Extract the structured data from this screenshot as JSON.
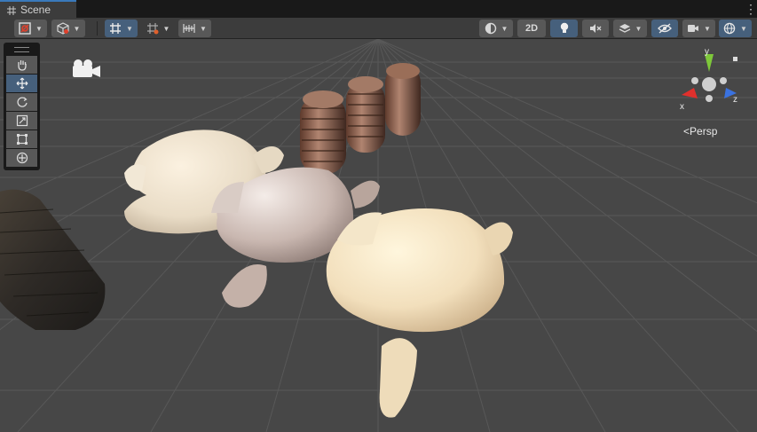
{
  "tab": {
    "title": "Scene"
  },
  "toolbar": {
    "draw_mode_icon": "render-mode-icon",
    "shading_icon": "cube-icon",
    "grid_snap_icon": "grid-icon",
    "increment_snap_icon": "snap-grid-icon",
    "ruler_icon": "ruler-icon",
    "lighting_icon": "sphere-shading-icon",
    "mode_2d_label": "2D",
    "light_icon": "lightbulb-icon",
    "audio_icon": "audio-mute-icon",
    "effects_icon": "layers-icon",
    "visibility_icon": "hidden-eye-icon",
    "camera_icon": "camera-icon",
    "gizmos_icon": "gizmo-globe-icon"
  },
  "tools": [
    {
      "name": "hand-tool",
      "icon": "hand-icon"
    },
    {
      "name": "move-tool",
      "icon": "move-arrows-icon",
      "active": true
    },
    {
      "name": "rotate-tool",
      "icon": "rotate-icon"
    },
    {
      "name": "scale-tool",
      "icon": "scale-icon"
    },
    {
      "name": "rect-tool",
      "icon": "rect-icon"
    },
    {
      "name": "transform-tool",
      "icon": "transform-icon"
    }
  ],
  "gizmo": {
    "x_label": "x",
    "y_label": "y",
    "z_label": "z",
    "x_color": "#e0302c",
    "y_color": "#7ec83a",
    "z_color": "#3a72e0"
  },
  "view": {
    "projection_label": "Persp"
  },
  "colors": {
    "accent": "#3a79bb",
    "active_button": "#46607c",
    "viewport_bg": "#474747"
  }
}
